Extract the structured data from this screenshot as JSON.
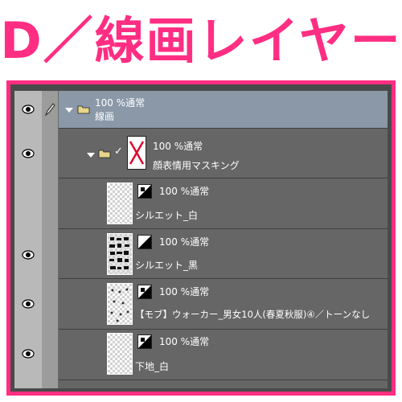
{
  "heading": "D／線画レイヤー",
  "colors": {
    "accent": "#ff2e83",
    "panel": "#5c5c5c",
    "selected_row": "#8a98a8"
  },
  "layers": [
    {
      "line1": "100 %通常",
      "line2": "線画",
      "type": "folder",
      "expanded": true,
      "selected": true,
      "visible": true,
      "editable": true
    },
    {
      "line1": "100 %通常",
      "line2": "顔表情用マスキング",
      "type": "folder",
      "expanded": true,
      "visible": true,
      "check": "✓"
    },
    {
      "line1": "100 %通常",
      "line2": "シルエット_白",
      "type": "layer",
      "visible": false
    },
    {
      "line1": "100 %通常",
      "line2": "シルエット_黒",
      "type": "layer",
      "visible": true
    },
    {
      "line1": "100 %通常",
      "line2": "【モブ】ウォーカー_男女10人(春夏秋服)④／トーンなし",
      "type": "layer",
      "visible": true
    },
    {
      "line1": "100 %通常",
      "line2": "下地_白",
      "type": "layer",
      "visible": true
    }
  ],
  "icons": [
    "eye-icon",
    "pen-icon",
    "folder-icon",
    "expand-arrow-icon",
    "check-icon",
    "layer-mask-icon"
  ]
}
